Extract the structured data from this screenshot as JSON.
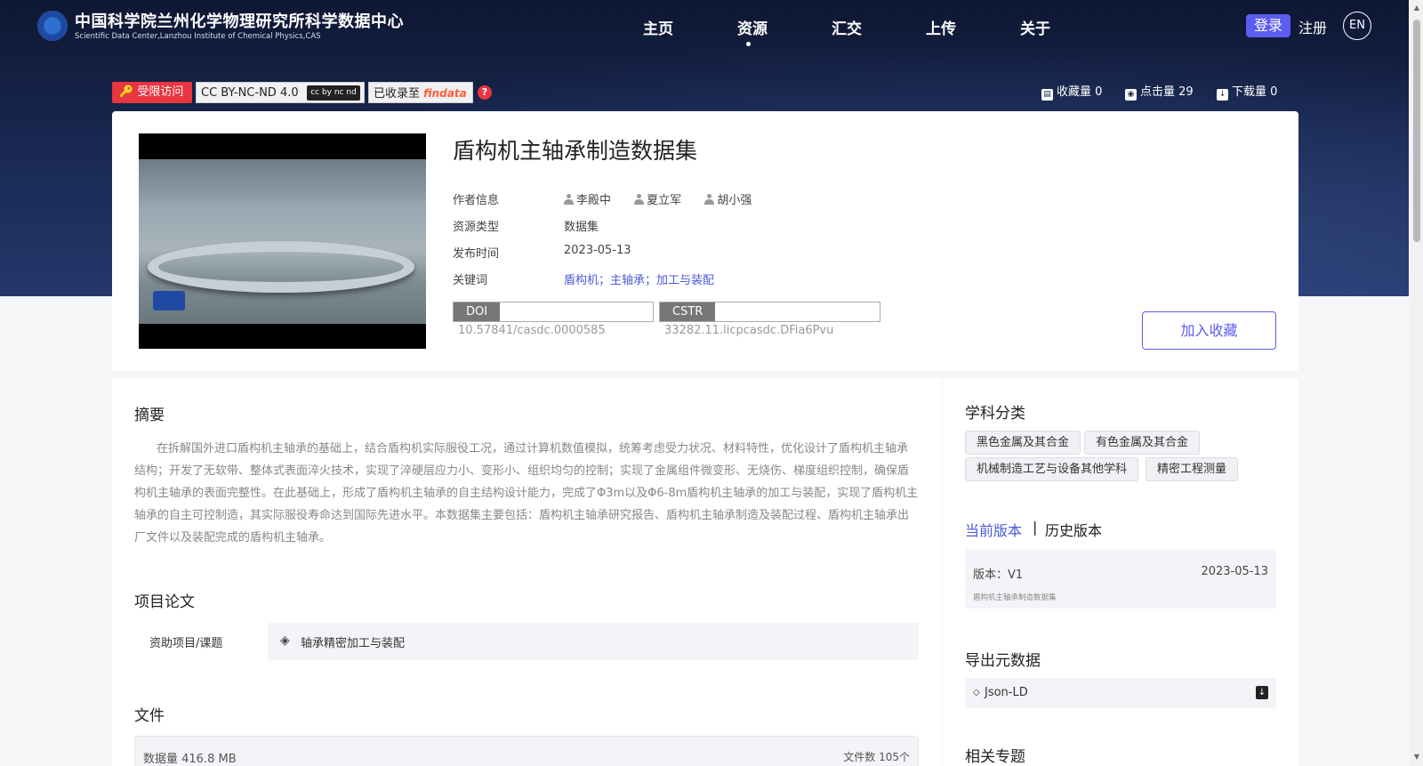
{
  "header": {
    "title": "中国科学院兰州化学物理研究所科学数据中心",
    "subtitle": "Scientific Data Center,Lanzhou Institute of Chemical Physics,CAS",
    "nav": [
      "主页",
      "资源",
      "汇交",
      "上传",
      "关于"
    ],
    "active_nav": "资源",
    "login": "登录",
    "register": "注册",
    "lang": "EN"
  },
  "badges": {
    "restricted": "受限访问",
    "license": "CC BY-NC-ND 4.0",
    "license_logo": "cc by nc nd",
    "collected": "已收录至",
    "findata": "findata",
    "help": "?"
  },
  "stats": {
    "favorites": "收藏量 0",
    "clicks": "点击量 29",
    "downloads": "下载量 0"
  },
  "dataset": {
    "title": "盾构机主轴承制造数据集",
    "labels": {
      "authors": "作者信息",
      "type": "资源类型",
      "date": "发布时间",
      "keywords": "关键词"
    },
    "authors": [
      "李殿中",
      "夏立军",
      "胡小强"
    ],
    "type": "数据集",
    "date": "2023-05-13",
    "keywords": "盾构机；主轴承；加工与装配",
    "doi_tag": "DOI",
    "doi": "10.57841/casdc.0000585",
    "cstr_tag": "CSTR",
    "cstr": "33282.11.licpcasdc.DFia6Pvu",
    "add_favorite": "加入收藏"
  },
  "abstract": {
    "title": "摘要",
    "text": "在拆解国外进口盾构机主轴承的基础上，结合盾构机实际服役工况，通过计算机数值模拟，统筹考虑受力状况、材料特性，优化设计了盾构机主轴承结构；开发了无软带、整体式表面淬火技术，实现了淬硬层应力小、变形小、组织均匀的控制；实现了金属组件微变形、无烧伤、梯度组织控制，确保盾构机主轴承的表面完整性。在此基础上，形成了盾构机主轴承的自主结构设计能力，完成了Φ3m以及Φ6-8m盾构机主轴承的加工与装配，实现了盾构机主轴承的自主可控制造，其实际服役寿命达到国际先进水平。本数据集主要包括：盾构机主轴承研究报告、盾构机主轴承制造及装配过程、盾构机主轴承出厂文件以及装配完成的盾构机主轴承。"
  },
  "project": {
    "title": "项目论文",
    "label": "资助项目/课题",
    "value": "轴承精密加工与装配"
  },
  "files": {
    "title": "文件",
    "size": "数据量 416.8 MB",
    "count": "文件数 105个"
  },
  "sidebar": {
    "subjects_title": "学科分类",
    "subjects": [
      "黑色金属及其合金",
      "有色金属及其合金",
      "机械制造工艺与设备其他学科",
      "精密工程测量"
    ],
    "version_current": "当前版本",
    "version_sep": "|",
    "version_history": "历史版本",
    "version_label": "版本：V1",
    "version_date": "2023-05-13",
    "version_name": "盾构机主轴承制造数据集",
    "export_title": "导出元数据",
    "export_format": "Json-LD",
    "related_title": "相关专题"
  },
  "colors": {
    "accent": "#5c5cf0",
    "restricted": "#e8353f",
    "keyword": "#4a5bd6",
    "hero": "#1a2a55"
  }
}
